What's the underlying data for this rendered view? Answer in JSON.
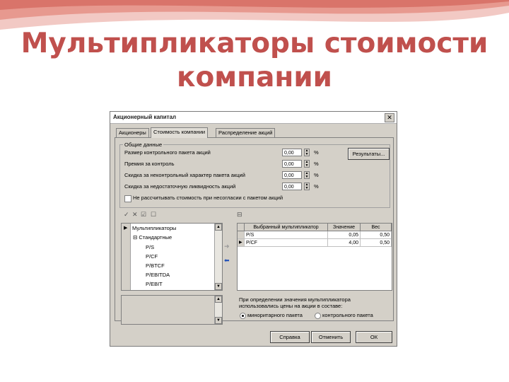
{
  "slide": {
    "title_line1": "Мультипликаторы стоимости",
    "title_line2": "компании",
    "title_color": "#c0504d"
  },
  "dialog": {
    "title": "Акционерный капитал",
    "tabs": [
      "Акционеры",
      "Стоимость компании",
      "Распределение акций"
    ],
    "active_tab": 1,
    "group_label": "Общие данные",
    "rows": [
      {
        "label": "Размер контрольного пакета акций",
        "value": "0,00",
        "unit": "%"
      },
      {
        "label": "Премия за контроль",
        "value": "0,00",
        "unit": "%"
      },
      {
        "label": "Скидка за неконтрольный характер пакета акций",
        "value": "0,00",
        "unit": "%"
      },
      {
        "label": "Скидка за недостаточную ликвидность акций",
        "value": "0,00",
        "unit": "%"
      }
    ],
    "results_button": "Результаты...",
    "checkbox_label": "Не рассчитывать стоимость при несогласии с пакетом акций",
    "tree": {
      "items": [
        {
          "label": "Мультипликаторы",
          "level": 0
        },
        {
          "label": "Стандартные",
          "level": 1
        },
        {
          "label": "P/S",
          "level": 2
        },
        {
          "label": "P/CF",
          "level": 2
        },
        {
          "label": "P/BTCF",
          "level": 2
        },
        {
          "label": "P/EBITDA",
          "level": 2
        },
        {
          "label": "P/EBIT",
          "level": 2
        }
      ]
    },
    "table": {
      "headers": [
        "Выбранный мультипликатор",
        "Значение",
        "Вес"
      ],
      "rows": [
        {
          "name": "P/S",
          "value": "0,05",
          "weight": "0,50"
        },
        {
          "name": "P/CF",
          "value": "4,00",
          "weight": "0,50"
        }
      ]
    },
    "note": "При определении значения мультипликатора использовались цены на акции в составе:",
    "radio_options": [
      "миноритарного пакета",
      "контрольного пакета"
    ],
    "radio_selected": 0,
    "buttons": {
      "help": "Справка",
      "cancel": "Отменить",
      "ok": "ОК"
    }
  }
}
